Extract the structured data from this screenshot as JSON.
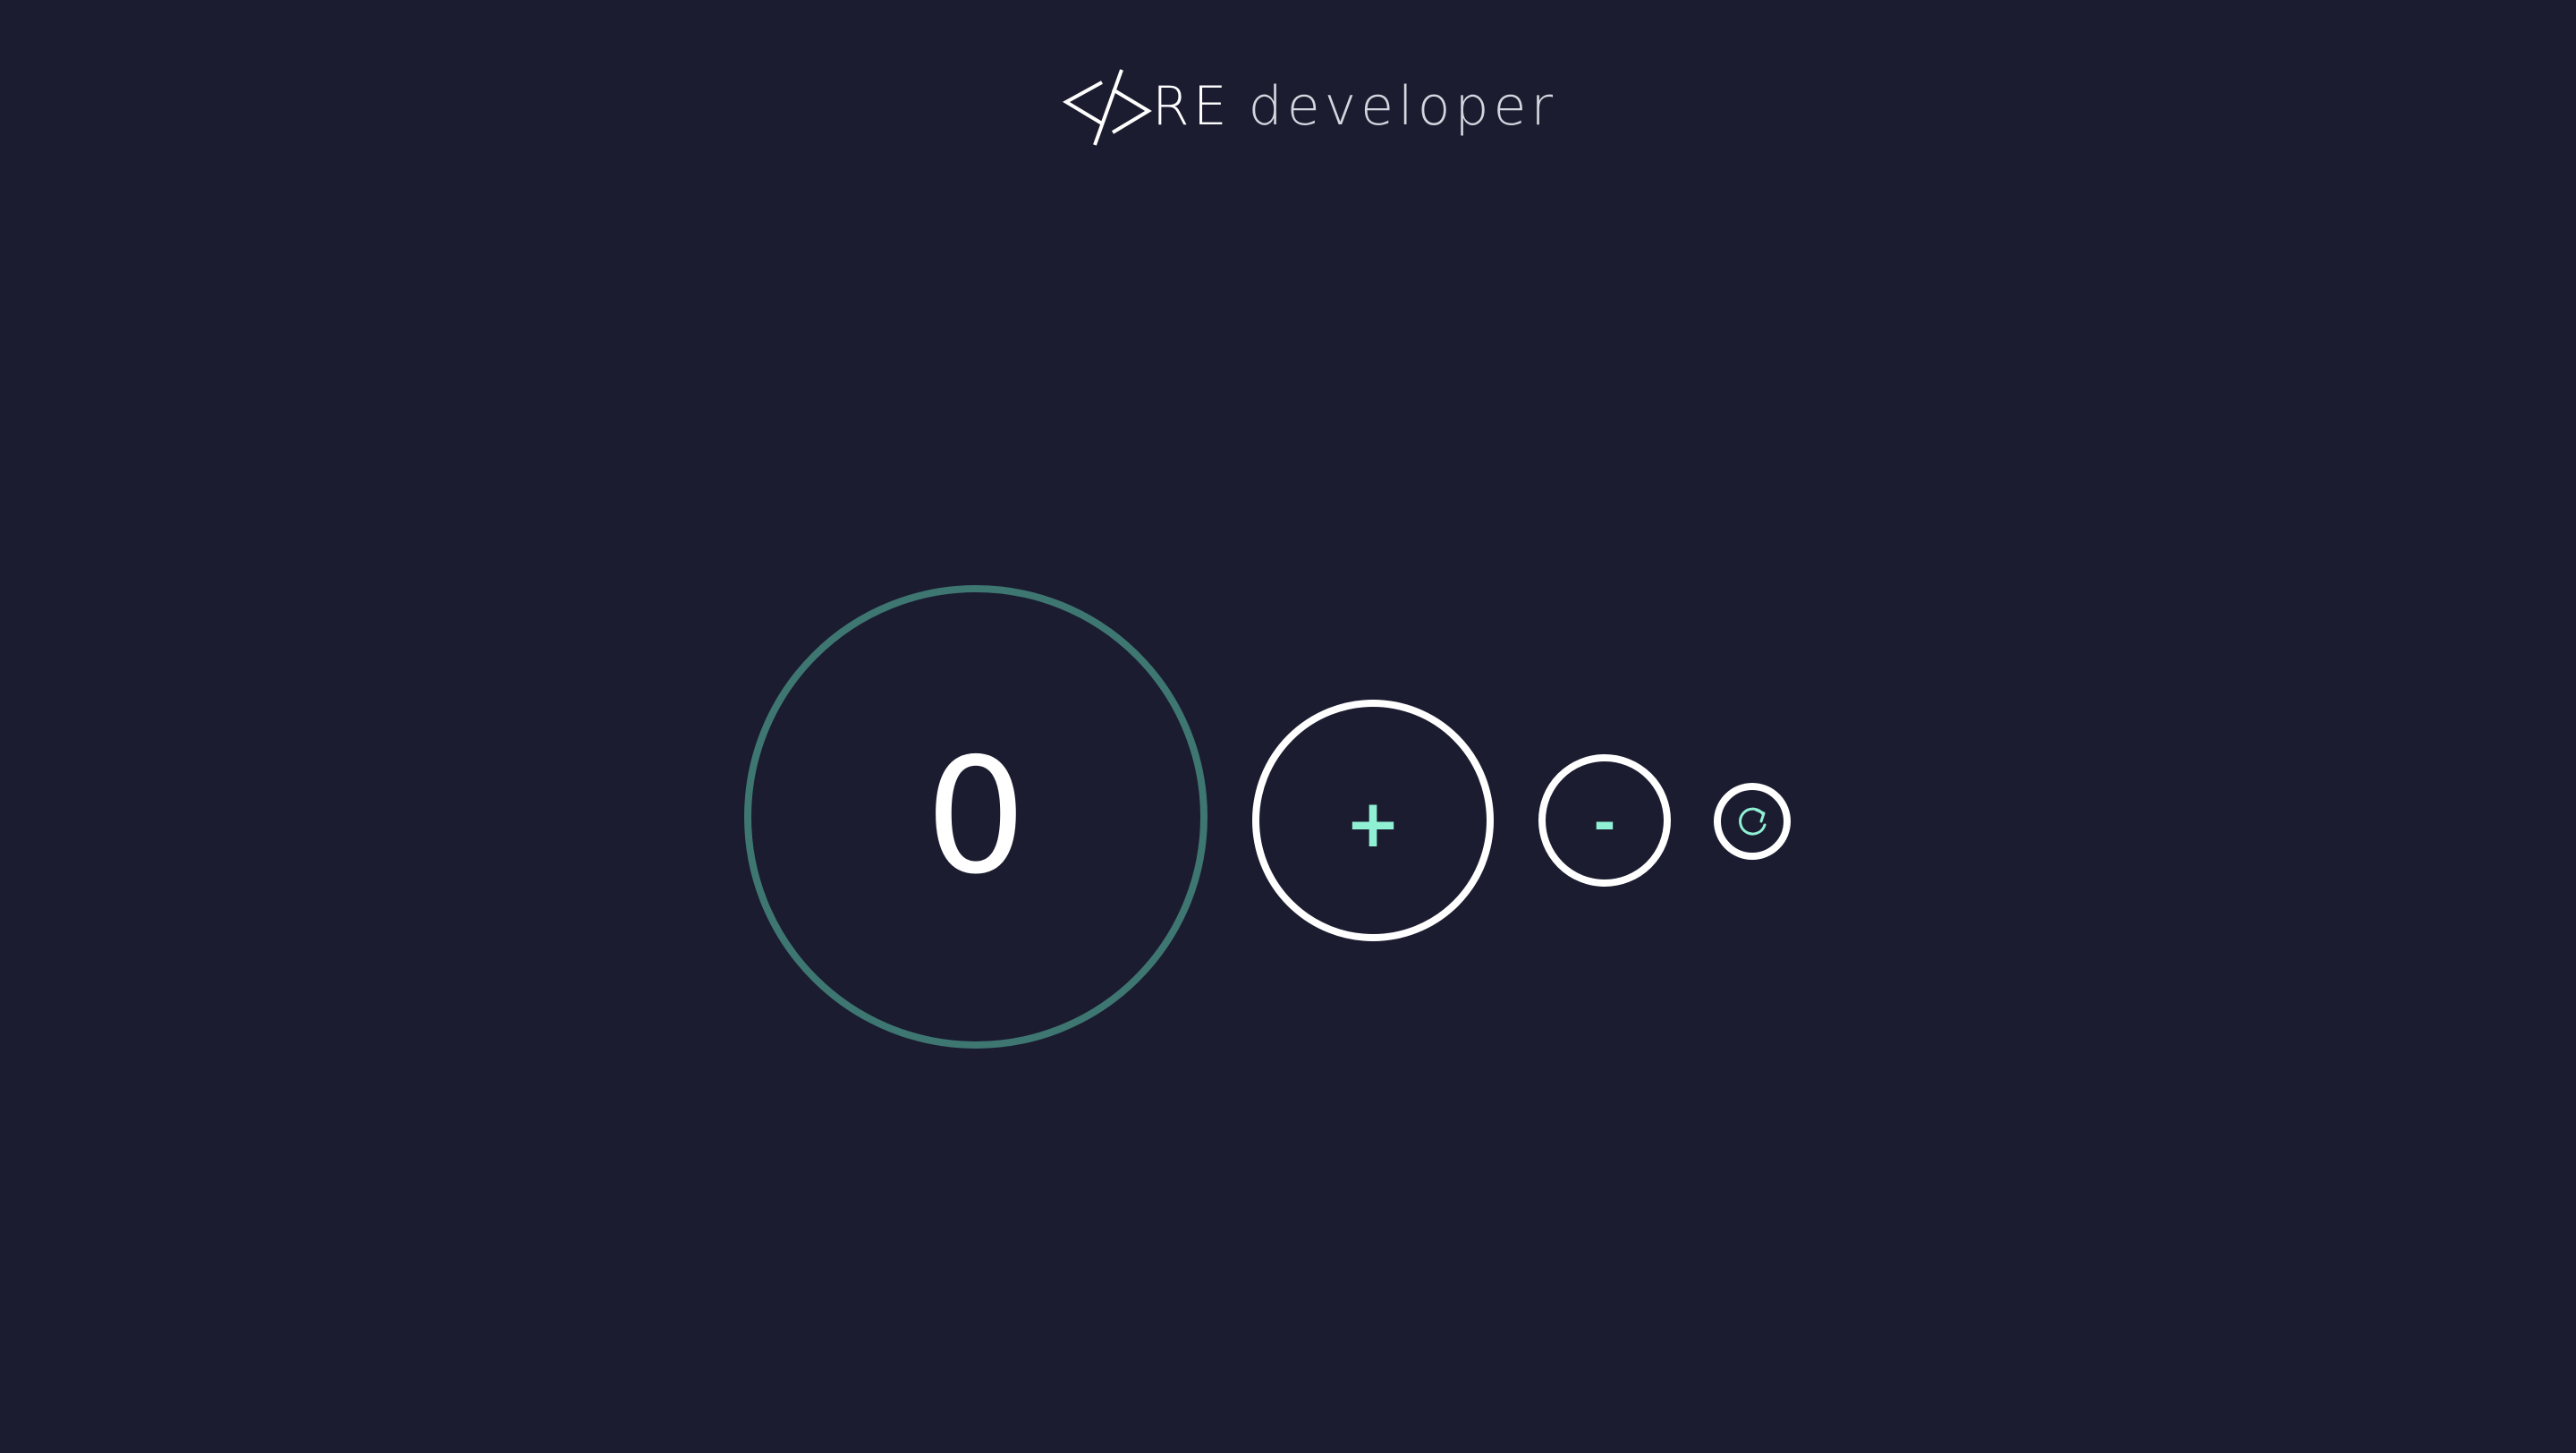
{
  "header": {
    "brand_prefix": "RE",
    "brand_suffix": "developer",
    "logo_icon": "code-slash-icon"
  },
  "counter": {
    "value": "0",
    "increment_label": "+",
    "decrement_label": "-",
    "reset_icon": "refresh-icon"
  },
  "colors": {
    "background": "#1b1c30",
    "display_ring": "#3e7672",
    "button_ring": "#ffffff",
    "accent": "#8ff0d4"
  }
}
